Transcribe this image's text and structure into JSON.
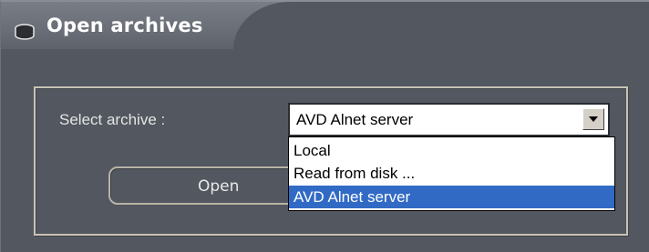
{
  "window": {
    "title": "Open archives",
    "icon": "drive-icon"
  },
  "archive_select": {
    "label": "Select archive :",
    "value": "AVD  Alnet server",
    "options": [
      "Local",
      "Read from disk ...",
      "AVD  Alnet server"
    ],
    "selected_index": 2
  },
  "buttons": {
    "open_label": "Open"
  },
  "colors": {
    "panel": "#525760",
    "selection": "#316ac5"
  }
}
